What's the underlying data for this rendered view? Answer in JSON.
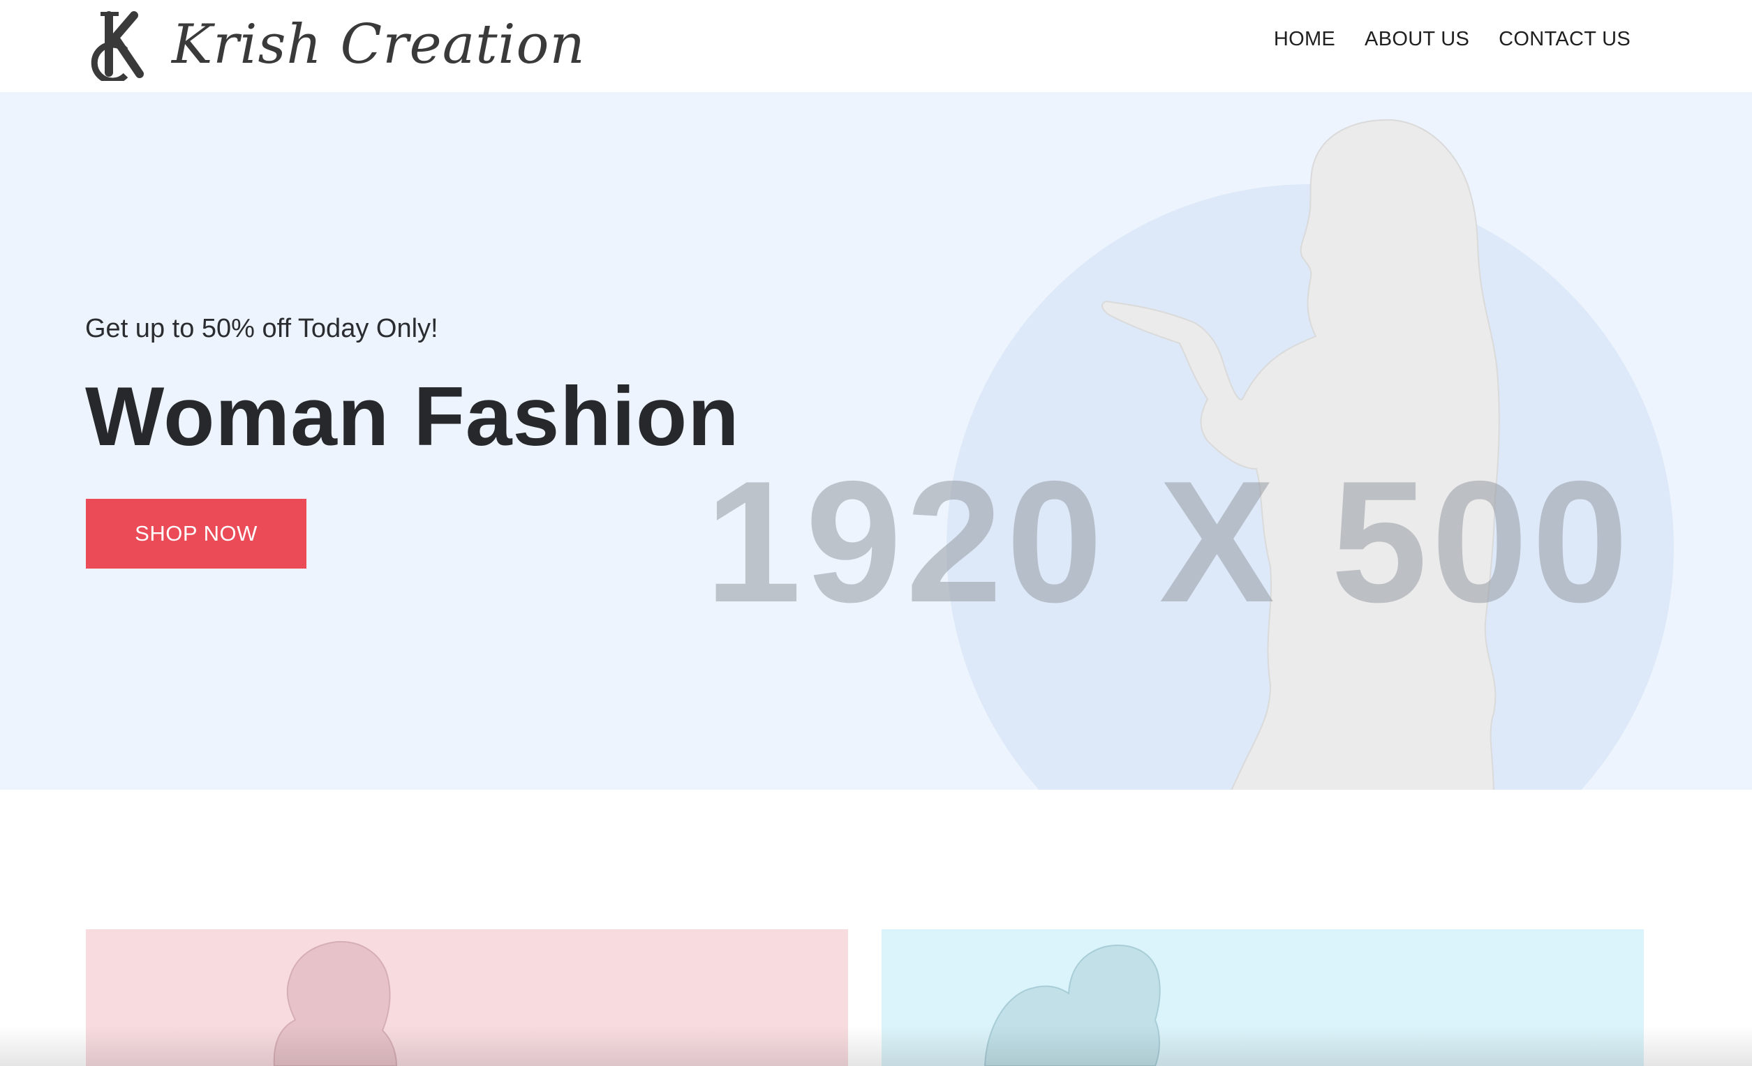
{
  "header": {
    "logo": {
      "monogram": "KC",
      "name": "Krish Creation"
    },
    "nav": [
      {
        "label": "HOME"
      },
      {
        "label": "ABOUT US"
      },
      {
        "label": "CONTACT US"
      }
    ]
  },
  "hero": {
    "kicker": "Get up to 50% off Today Only!",
    "title": "Woman Fashion",
    "cta_label": "SHOP NOW",
    "placeholder_text": "1920 X 500",
    "colors": {
      "background": "#edf4fd",
      "circle": "#dde9f8",
      "silhouette": "#ebebeb",
      "cta": "#eb4a57"
    }
  },
  "tiles": [
    {
      "name": "pink-category-tile",
      "color": "#f7dbdf"
    },
    {
      "name": "cyan-category-tile",
      "color": "#dbf3fa"
    }
  ]
}
